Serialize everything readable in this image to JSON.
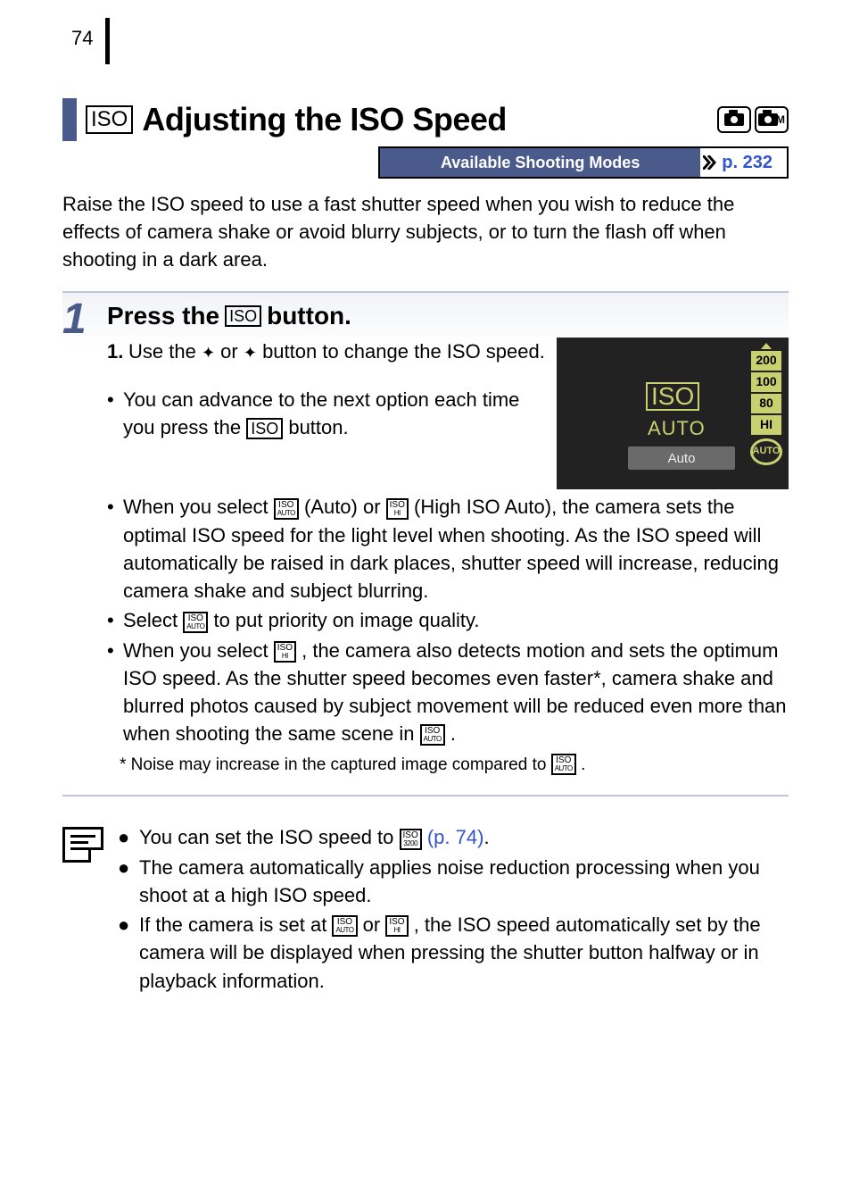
{
  "page_number": "74",
  "title": "Adjusting the ISO Speed",
  "iso_badge": "ISO",
  "available_modes": {
    "label": "Available Shooting Modes",
    "page_ref": "p. 232"
  },
  "intro": "Raise the ISO speed to use a fast shutter speed when you wish to reduce the effects of camera shake or avoid blurry subjects, or to turn the flash off when shooting in a dark area.",
  "step": {
    "number": "1",
    "title_pre": "Press the ",
    "title_post": " button.",
    "item1_num": "1.",
    "item1_a": "Use the ",
    "item1_b": " or ",
    "item1_c": " button to change the ISO speed.",
    "bullet1_a": "You can advance to the next option each time you press the ",
    "bullet1_b": " button.",
    "bullet2_a": "When you select ",
    "bullet2_b": " (Auto) or ",
    "bullet2_c": " (High ISO Auto), the camera sets the optimal ISO speed for the light level when shooting. As the ISO speed will automatically be raised in dark places, shutter speed will increase, reducing camera shake and subject blurring.",
    "bullet3_a": "Select ",
    "bullet3_b": " to put priority on image quality.",
    "bullet4_a": "When you select ",
    "bullet4_b": ", the camera also detects motion and sets the optimum ISO speed. As the shutter speed becomes even faster*, camera shake and blurred photos caused by subject movement will be reduced even more than when shooting the same scene in ",
    "bullet4_c": ".",
    "footnote_a": "* Noise may increase in the captured image compared to ",
    "footnote_b": "."
  },
  "screenshot": {
    "iso_label": "ISO",
    "auto_label": "AUTO",
    "bar_text": "Auto",
    "ladder": [
      "200",
      "100",
      "80",
      "HI"
    ],
    "selected": "AUTO"
  },
  "notes": {
    "n1_a": "You can set the ISO speed to ",
    "n1_b": " (p. 74)",
    "n1_c": ".",
    "n2": "The camera automatically applies noise reduction processing when you shoot at a high ISO speed.",
    "n3_a": "If the camera is set at ",
    "n3_b": " or ",
    "n3_c": ", the ISO speed automatically set by the camera will be displayed when pressing the shutter button halfway or in playback information."
  },
  "icons": {
    "iso_auto_top": "ISO",
    "iso_auto_bot": "AUTO",
    "iso_hi_top": "ISO",
    "iso_hi_bot": "HI",
    "iso_3200_top": "ISO",
    "iso_3200_bot": "3200"
  }
}
